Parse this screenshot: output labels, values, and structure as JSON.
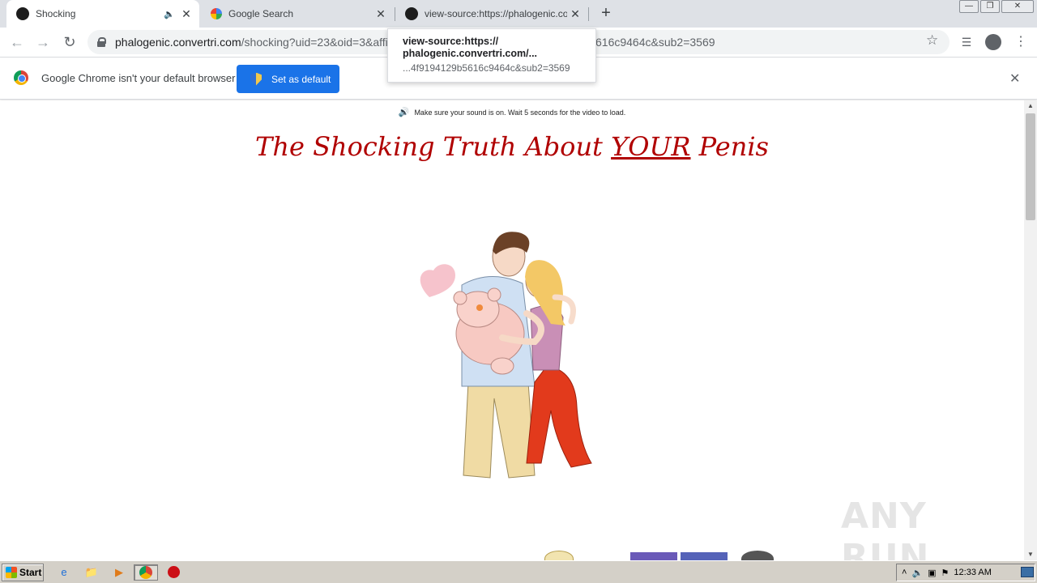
{
  "tabs": [
    {
      "title": "Shocking",
      "active": true,
      "audio": true
    },
    {
      "title": "Google Search",
      "active": false,
      "audio": false
    },
    {
      "title": "view-source:https://phalogenic.conv",
      "active": false,
      "audio": false
    }
  ],
  "toolbar": {
    "url_host": "phalogenic.convertri.com",
    "url_path": "/shocking?uid=23&oid=3&affi",
    "url_tail": "616c9464c&sub2=3569"
  },
  "tooltip": {
    "title": "view-source:https:// phalogenic.convertri.com/...",
    "url": "...4f9194129b5616c9464c&sub2=3569"
  },
  "infobar": {
    "message": "Google Chrome isn't your default browser",
    "button_label": "Set as default"
  },
  "page": {
    "notice": "Make sure your sound is on. Wait 5 seconds for the video to load.",
    "headline_pre": "The Shocking Truth About ",
    "headline_emph": "YOUR",
    "headline_post": " Penis",
    "watermark": "ANY RUN"
  },
  "taskbar": {
    "start_label": "Start",
    "clock": "12:33 AM"
  },
  "colors": {
    "headline": "#b00000",
    "accent_button": "#1a73e8"
  }
}
